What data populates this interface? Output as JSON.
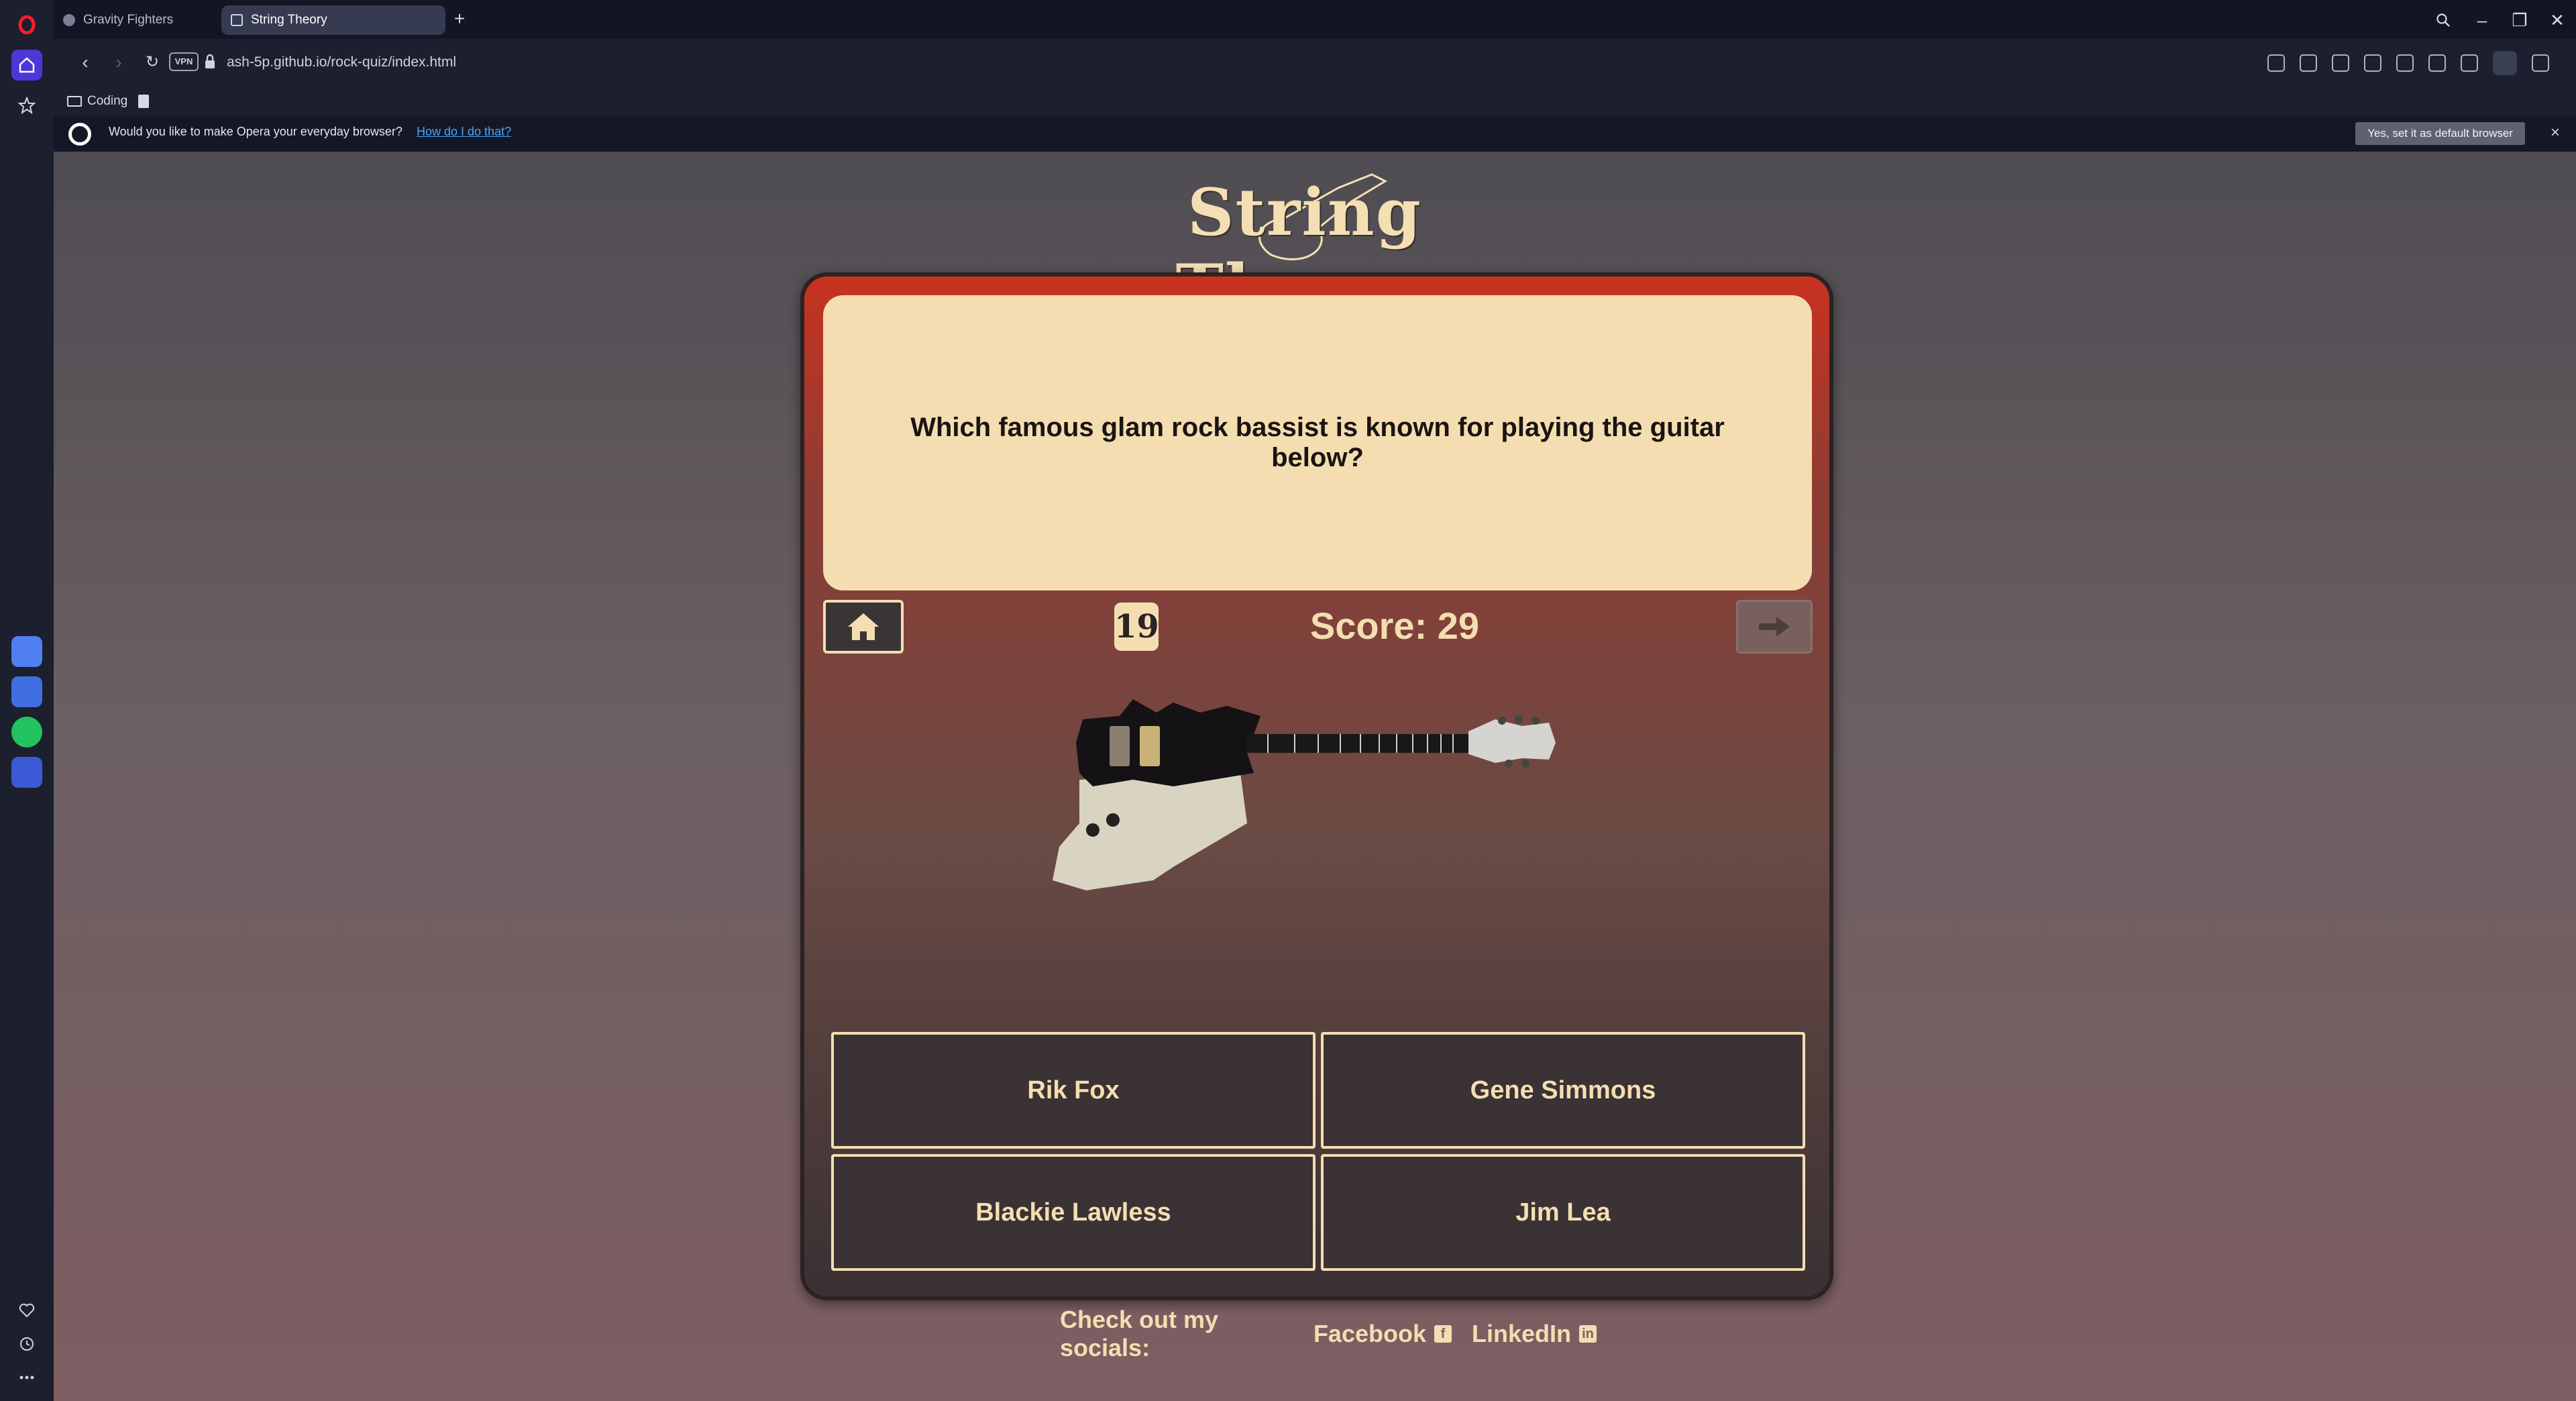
{
  "browser": {
    "tabs": [
      {
        "label": "Gravity Fighters",
        "active": false
      },
      {
        "label": "String Theory",
        "active": true
      }
    ],
    "url": "ash-5p.github.io/rock-quiz/index.html",
    "vpn_label": "VPN",
    "bookmarks": [
      {
        "label": "Coding"
      }
    ],
    "banner": {
      "text": "Would you like to make Opera your everyday browser?",
      "link": "How do I do that?",
      "button": "Yes, set it as default browser"
    }
  },
  "quiz": {
    "logo": "String Theory",
    "question": "Which famous glam rock bassist is known for playing the guitar below?",
    "question_number": "19",
    "score_label": "Score: 29",
    "answers": [
      "Rik Fox",
      "Gene Simmons",
      "Blackie Lawless",
      "Jim Lea"
    ]
  },
  "footer": {
    "label": "Check out my socials:",
    "links": [
      "Facebook",
      "LinkedIn"
    ]
  },
  "colors": {
    "accent_cream": "#f4deb1",
    "card_red": "#c8321f",
    "opera_purple": "#4a39d6"
  }
}
